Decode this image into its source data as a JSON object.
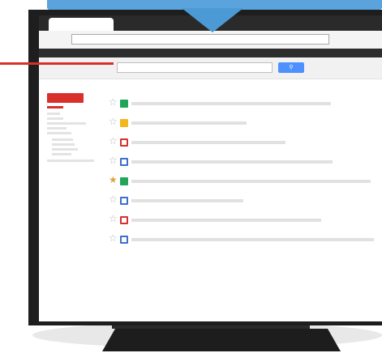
{
  "colors": {
    "banner": "#5ba3dc",
    "accent_red": "#d9302c",
    "search_button": "#4d90fe",
    "label_green": "#22a55b",
    "label_yellow": "#f3b61f",
    "label_blue": "#3c6fcb",
    "monitor_frame": "#1e1e1e"
  },
  "search": {
    "button_icon": "search-icon"
  },
  "sidebar": {
    "items": [
      {
        "active": true
      },
      {
        "active": false
      },
      {
        "active": false
      },
      {
        "active": false
      },
      {
        "active": false
      },
      {
        "active": false
      },
      {
        "active": false
      },
      {
        "active": false
      },
      {
        "active": false
      },
      {
        "active": false
      },
      {
        "active": false
      }
    ]
  },
  "emails": [
    {
      "starred": false,
      "label": "solid-green"
    },
    {
      "starred": false,
      "label": "solid-yellow"
    },
    {
      "starred": false,
      "label": "outline-red"
    },
    {
      "starred": false,
      "label": "outline-blue"
    },
    {
      "starred": true,
      "label": "solid-green"
    },
    {
      "starred": false,
      "label": "outline-blue"
    },
    {
      "starred": false,
      "label": "outline-red"
    },
    {
      "starred": false,
      "label": "outline-blue"
    }
  ]
}
